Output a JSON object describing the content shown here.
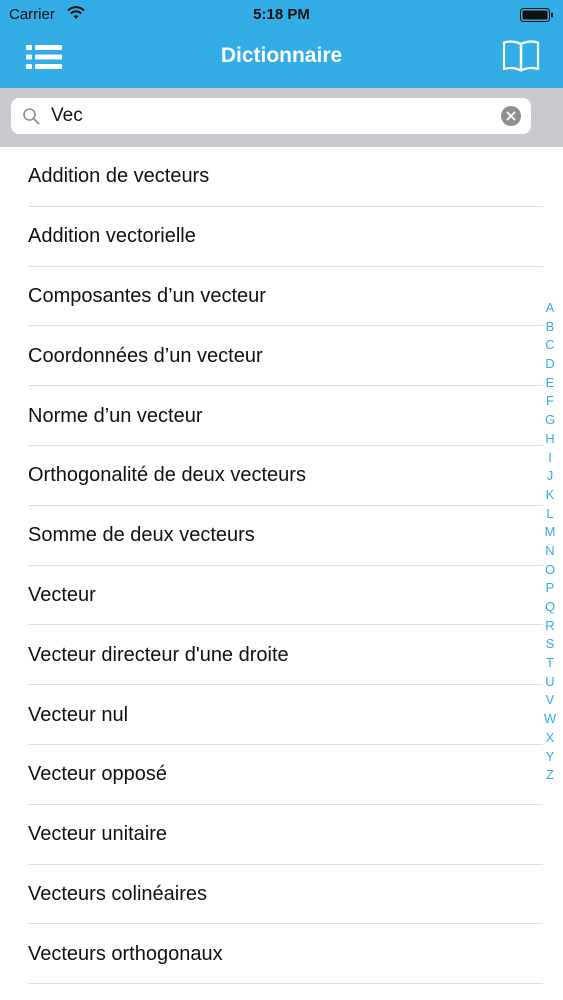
{
  "status_bar": {
    "carrier": "Carrier",
    "time": "5:18 PM",
    "icons": [
      "wifi-icon",
      "battery-icon"
    ]
  },
  "nav": {
    "title": "Dictionnaire",
    "left_icon": "list-icon",
    "right_icon": "book-icon",
    "bar_color": "#33ade6"
  },
  "search": {
    "value": "Vec",
    "icon": "search-icon",
    "clear_icon": "clear-icon"
  },
  "results": [
    "Addition de vecteurs",
    "Addition vectorielle",
    "Composantes d’un vecteur",
    "Coordonnées d’un vecteur",
    "Norme d’un vecteur",
    "Orthogonalité de deux vecteurs",
    "Somme de deux vecteurs",
    "Vecteur",
    "Vecteur directeur d'une droite",
    "Vecteur nul",
    "Vecteur opposé",
    "Vecteur unitaire",
    "Vecteurs colinéaires",
    "Vecteurs orthogonaux"
  ],
  "alphabet_index": [
    "A",
    "B",
    "C",
    "D",
    "E",
    "F",
    "G",
    "H",
    "I",
    "J",
    "K",
    "L",
    "M",
    "N",
    "O",
    "P",
    "Q",
    "R",
    "S",
    "T",
    "U",
    "V",
    "W",
    "X",
    "Y",
    "Z"
  ],
  "colors": {
    "accent": "#33ade6",
    "search_area": "#c8c8cd"
  }
}
